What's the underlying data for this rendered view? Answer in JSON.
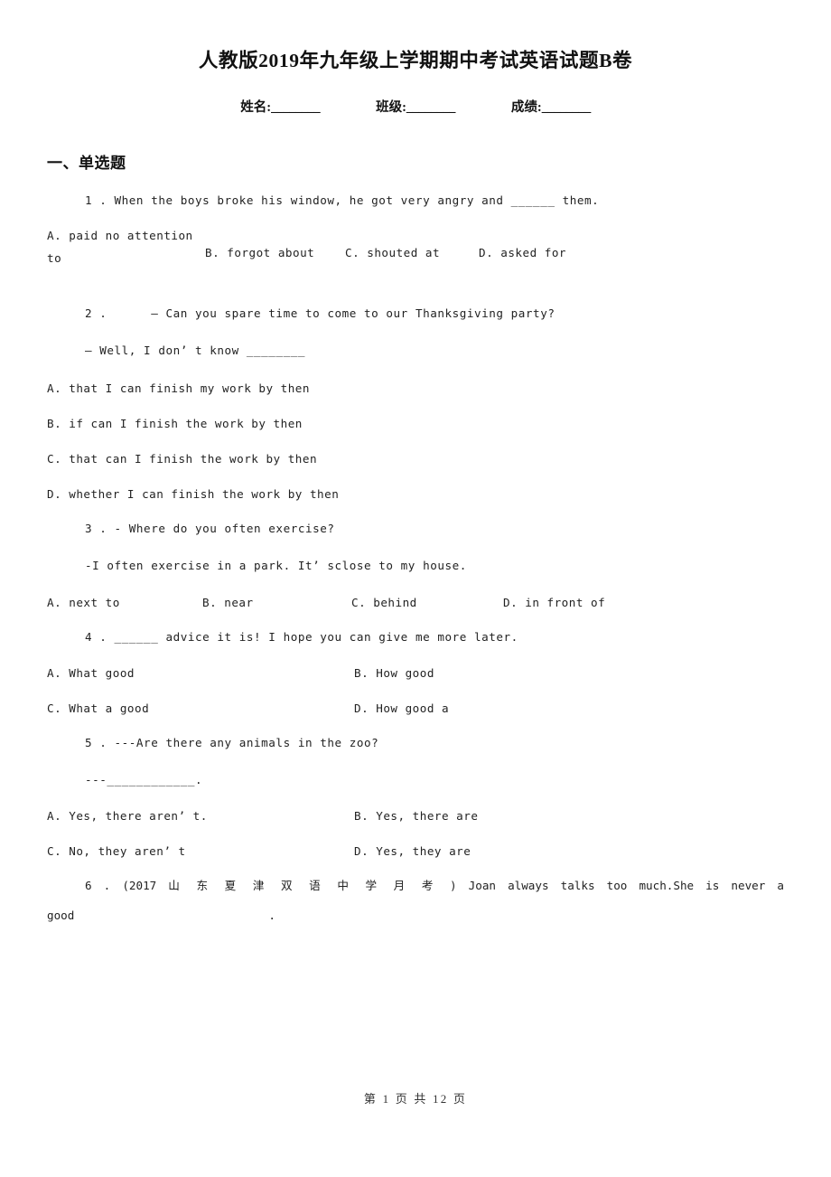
{
  "document": {
    "title": "人教版2019年九年级上学期期中考试英语试题B卷",
    "info_fields": [
      {
        "label": "姓名:",
        "blank": "________"
      },
      {
        "label": "班级:",
        "blank": "________"
      },
      {
        "label": "成绩:",
        "blank": "________"
      }
    ],
    "section_heading": "一、单选题",
    "footer": "第 1 页 共 12 页"
  },
  "questions": [
    {
      "number": "1",
      "stem": "1 . When the boys broke his window, he got very angry and ______ them.",
      "options": {
        "a_first": "A. paid no attention",
        "a_cont": "to",
        "b": "B. forgot about",
        "c": "C. shouted at",
        "d": "D. asked for"
      }
    },
    {
      "number": "2",
      "stem": "2 .      — Can you spare time to come to our Thanksgiving party?",
      "stem2": "— Well, I don’ t know ________",
      "options": [
        "A. that I can finish my work by then",
        "B. if can I finish the work by then",
        "C. that can I finish the work by then",
        "D. whether I can finish the work by then"
      ]
    },
    {
      "number": "3",
      "stem": "3 . - Where do you often exercise?",
      "stem2": "-I often exercise in a park. It’ sclose to my house.",
      "options": [
        "A. next to",
        "B. near",
        "C. behind",
        "D. in front of"
      ]
    },
    {
      "number": "4",
      "stem": "4 . ______ advice it is! I hope you can give me more later.",
      "options": [
        "A. What good",
        "B. How good",
        "C. What a good",
        "D. How good a"
      ]
    },
    {
      "number": "5",
      "stem": "5 . ---Are there any animals in the zoo?",
      "stem2": "---____________.",
      "options": [
        "A. Yes, there aren’ t.",
        "B. Yes, there are",
        "C. No, they aren’ t",
        "D. Yes, they are"
      ]
    },
    {
      "number": "6",
      "stem_line1": "6 . (2017 山 东 夏 津 双 语 中 学 月 考 ) Joan always talks too much.She is never a",
      "stem_line2_word": "good",
      "stem_line2_period": "."
    }
  ]
}
